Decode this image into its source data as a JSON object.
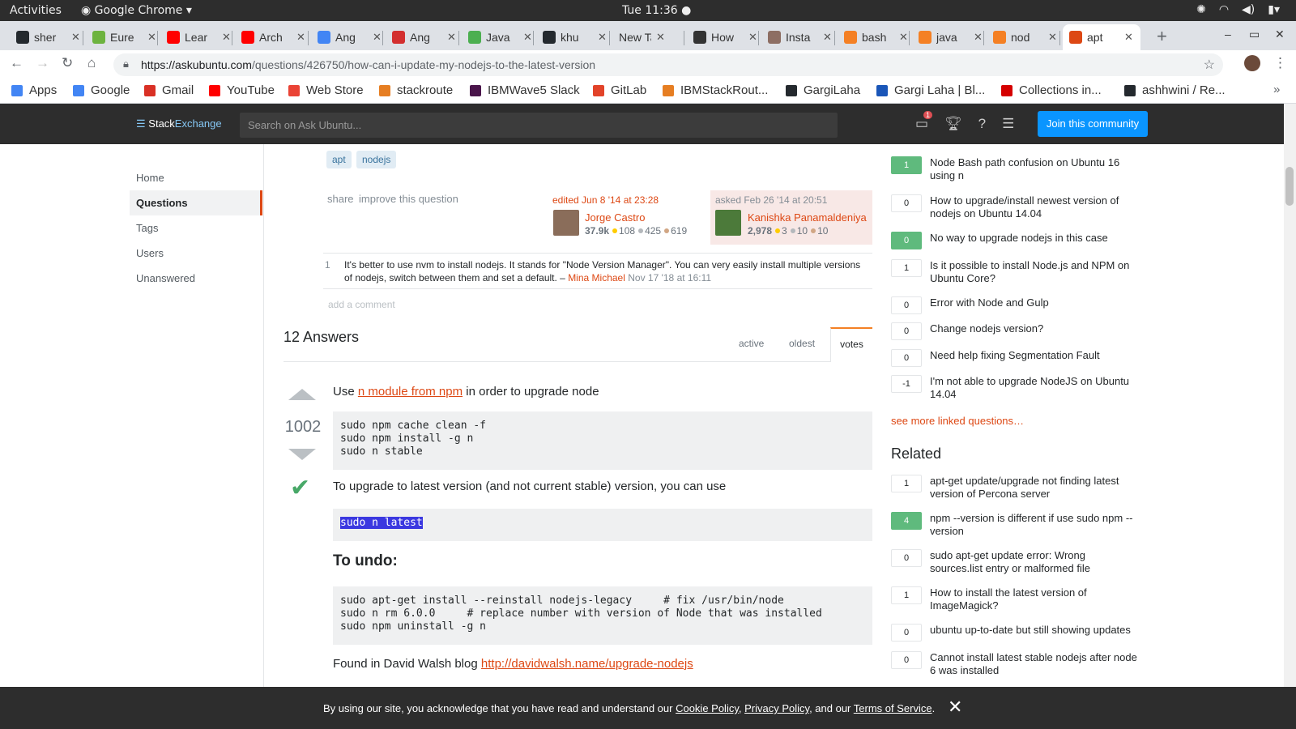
{
  "os": {
    "activities": "Activities",
    "app": "Google Chrome",
    "clock": "Tue 11:36"
  },
  "tabs": [
    {
      "title": "sher",
      "color": "#24292e"
    },
    {
      "title": "Eure",
      "color": "#6db33f"
    },
    {
      "title": "Lear",
      "color": "#ff0000"
    },
    {
      "title": "Arch",
      "color": "#ff0000"
    },
    {
      "title": "Ang",
      "color": "#4285f4"
    },
    {
      "title": "Ang",
      "color": "#d32f2f"
    },
    {
      "title": "Java",
      "color": "#4caf50"
    },
    {
      "title": "khu",
      "color": "#24292e"
    },
    {
      "title": "New Tal",
      "color": ""
    },
    {
      "title": "How",
      "color": "#333333"
    },
    {
      "title": "Insta",
      "color": "#8d6e63"
    },
    {
      "title": "bash",
      "color": "#f48024"
    },
    {
      "title": "java",
      "color": "#f48024"
    },
    {
      "title": "nod",
      "color": "#f48024"
    },
    {
      "title": "apt",
      "color": "#dd4814"
    }
  ],
  "toolbar": {
    "url_host": "https://askubuntu.com",
    "url_path": "/questions/426750/how-can-i-update-my-nodejs-to-the-latest-version"
  },
  "bookmarks": [
    "Apps",
    "Google",
    "Gmail",
    "YouTube",
    "Web Store",
    "stackroute",
    "IBMWave5 Slack",
    "GitLab",
    "IBMStackRout...",
    "GargiLaha",
    "Gargi Laha | Bl...",
    "Collections in...",
    "ashhwini / Re..."
  ],
  "se": {
    "logo_a": "Stack",
    "logo_b": "Exchange",
    "search_placeholder": "Search on Ask Ubuntu...",
    "join": "Join this community",
    "badge": "1"
  },
  "leftnav": [
    "Home",
    "Questions",
    "Tags",
    "Users",
    "Unanswered"
  ],
  "question": {
    "tags": [
      "apt",
      "nodejs"
    ],
    "share": "share",
    "improve": "improve this question",
    "edited": "edited Jun 8 '14 at 23:28",
    "editor": "Jorge Castro",
    "editor_rep": "37.9k",
    "editor_gold": "108",
    "editor_silver": "425",
    "editor_bronze": "619",
    "asked": "asked Feb 26 '14 at 20:51",
    "asker": "Kanishka Panamaldeniya",
    "asker_rep": "2,978",
    "asker_gold": "3",
    "asker_silver": "10",
    "asker_bronze": "10",
    "comment_score": "1",
    "comment_text": "It's better to use nvm to install nodejs. It stands for \"Node Version Manager\". You can very easily install multiple versions of nodejs, switch between them and set a default. –",
    "comment_user": "Mina Michael",
    "comment_date": "Nov 17 '18 at 16:11",
    "add_comment": "add a comment"
  },
  "answers": {
    "count": "12 Answers",
    "sort": [
      "active",
      "oldest",
      "votes"
    ],
    "votes": "1002",
    "use_pre": "Use",
    "use_link": "n module from npm",
    "use_post": "in order to upgrade node",
    "code1": "sudo npm cache clean -f\nsudo npm install -g n\nsudo n stable",
    "upgrade_text": "To upgrade to latest version (and not current stable) version, you can use",
    "code2": "sudo n latest",
    "undo_heading": "To undo:",
    "code3": "sudo apt-get install --reinstall nodejs-legacy     # fix /usr/bin/node\nsudo n rm 6.0.0     # replace number with version of Node that was installed\nsudo npm uninstall -g n",
    "found_pre": "Found in David Walsh blog",
    "found_link": "http://davidwalsh.name/upgrade-nodejs"
  },
  "linked": [
    {
      "count": "1",
      "accepted": true,
      "title": "Node Bash path confusion on Ubuntu 16 using n"
    },
    {
      "count": "0",
      "accepted": false,
      "title": "How to upgrade/install newest version of nodejs on Ubuntu 14.04"
    },
    {
      "count": "0",
      "accepted": true,
      "title": "No way to upgrade nodejs in this case"
    },
    {
      "count": "1",
      "accepted": false,
      "title": "Is it possible to install Node.js and NPM on Ubuntu Core?"
    },
    {
      "count": "0",
      "accepted": false,
      "title": "Error with Node and Gulp"
    },
    {
      "count": "0",
      "accepted": false,
      "title": "Change nodejs version?"
    },
    {
      "count": "0",
      "accepted": false,
      "title": "Need help fixing Segmentation Fault"
    },
    {
      "count": "-1",
      "accepted": false,
      "title": "I'm not able to upgrade NodeJS on Ubuntu 14.04"
    }
  ],
  "see_more": "see more linked questions…",
  "related_heading": "Related",
  "related": [
    {
      "count": "1",
      "accepted": false,
      "title": "apt-get update/upgrade not finding latest version of Percona server"
    },
    {
      "count": "4",
      "accepted": true,
      "title": "npm --version is different if use sudo npm --version"
    },
    {
      "count": "0",
      "accepted": false,
      "title": "sudo apt-get update error: Wrong sources.list entry or malformed file"
    },
    {
      "count": "1",
      "accepted": false,
      "title": "How to install the latest version of ImageMagick?"
    },
    {
      "count": "0",
      "accepted": false,
      "title": "ubuntu up-to-date but still showing updates"
    },
    {
      "count": "0",
      "accepted": false,
      "title": "Cannot install latest stable nodejs after node 6 was installed"
    }
  ],
  "cookie": {
    "pre": "By using our site, you acknowledge that you have read and understand our",
    "cookie": "Cookie Policy",
    "privacy": "Privacy Policy",
    "and": ", and our",
    "terms": "Terms of Service",
    "end": "."
  }
}
